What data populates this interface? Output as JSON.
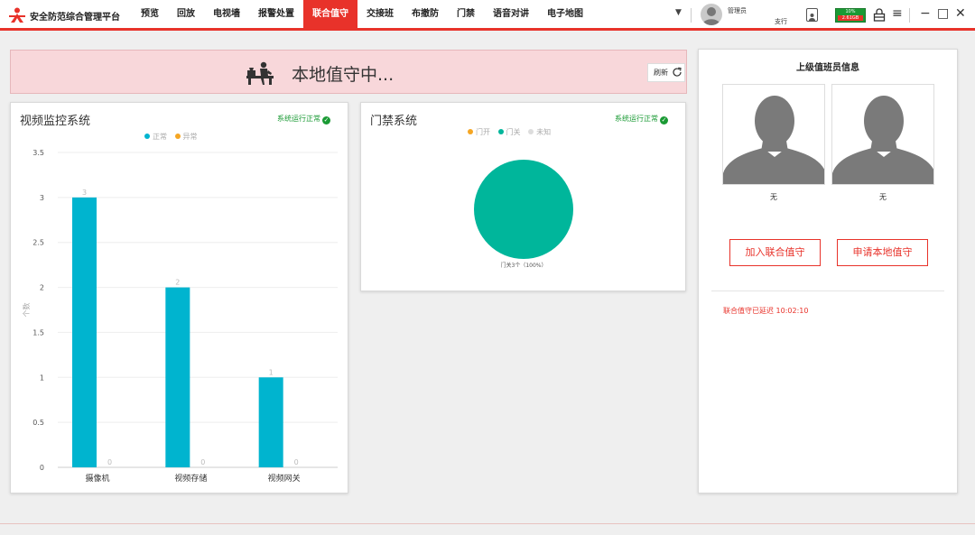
{
  "app": {
    "title": "安全防范综合管理平台"
  },
  "nav": [
    {
      "label": "预览",
      "active": false
    },
    {
      "label": "回放",
      "active": false
    },
    {
      "label": "电视墙",
      "active": false
    },
    {
      "label": "报警处置",
      "active": false
    },
    {
      "label": "联合值守",
      "active": true
    },
    {
      "label": "交接班",
      "active": false
    },
    {
      "label": "布撤防",
      "active": false
    },
    {
      "label": "门禁",
      "active": false
    },
    {
      "label": "语音对讲",
      "active": false
    },
    {
      "label": "电子地图",
      "active": false
    }
  ],
  "user": {
    "name": "管理员",
    "role": "支行"
  },
  "battery": {
    "top_label": "10%",
    "bottom_label": "2.61GB"
  },
  "colors": {
    "accent": "#e8322a",
    "teal": "#00b4cf",
    "green": "#1a9a34",
    "pie": "#00b69b",
    "orange": "#f5a623"
  },
  "banner": {
    "text": "本地值守中...",
    "refresh_label": "刷新"
  },
  "video_panel": {
    "title": "视频监控系统",
    "status": "系统运行正常",
    "legend": [
      {
        "label": "正常",
        "color": "#00b4cf"
      },
      {
        "label": "异常",
        "color": "#f5a623"
      }
    ],
    "y_axis_label": "个数"
  },
  "access_panel": {
    "title": "门禁系统",
    "status": "系统运行正常",
    "legend": [
      {
        "label": "门开",
        "color": "#f5a623"
      },
      {
        "label": "门关",
        "color": "#00b69b"
      },
      {
        "label": "未知",
        "color": "#dddddd"
      }
    ],
    "pie_label": "门关3个（100%）"
  },
  "chart_data": [
    {
      "type": "bar",
      "categories": [
        "摄像机",
        "视频存储",
        "视频网关"
      ],
      "series": [
        {
          "name": "正常",
          "values": [
            3,
            2,
            1
          ]
        },
        {
          "name": "异常",
          "values": [
            0,
            0,
            0
          ]
        }
      ],
      "ylabel": "个数",
      "ylim": [
        0,
        3.5
      ],
      "yticks": [
        0,
        0.5,
        1,
        1.5,
        2,
        2.5,
        3,
        3.5
      ],
      "legend": "top"
    },
    {
      "type": "pie",
      "slices": [
        {
          "label": "门开",
          "value": 0
        },
        {
          "label": "门关",
          "value": 3
        },
        {
          "label": "未知",
          "value": 0
        }
      ],
      "legend": "top"
    }
  ],
  "supervisor_panel": {
    "title": "上级值班员信息",
    "persons": [
      {
        "name": "无"
      },
      {
        "name": "无"
      }
    ],
    "join_button": "加入联合值守",
    "apply_button": "申请本地值守",
    "delay_text": "联合值守已延迟 10:02:10"
  }
}
